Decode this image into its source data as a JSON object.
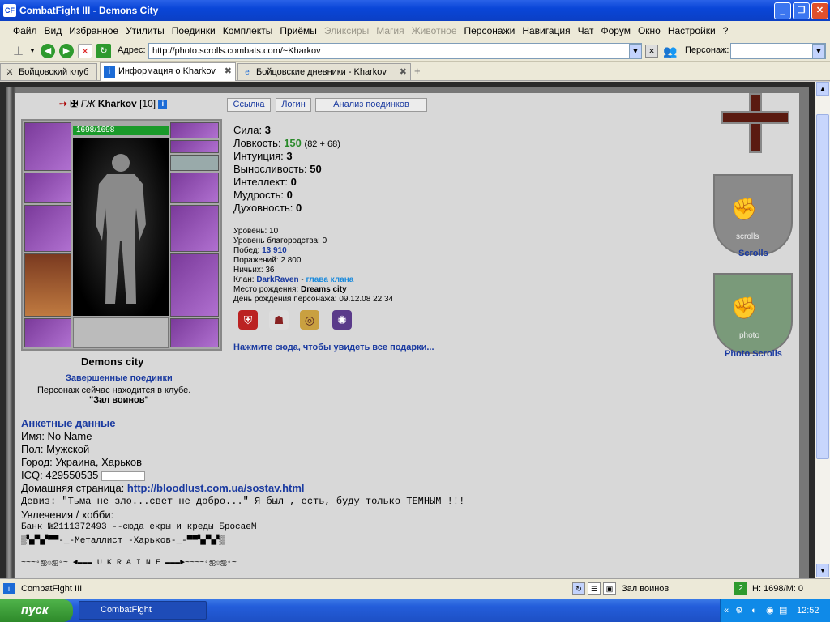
{
  "window": {
    "title": "CombatFight III - Demons City"
  },
  "menu": [
    "Файл",
    "Вид",
    "Избранное",
    "Утилиты",
    "Поединки",
    "Комплекты",
    "Приёмы",
    "Эликсиры",
    "Магия",
    "Животное",
    "Персонажи",
    "Навигация",
    "Чат",
    "Форум",
    "Окно",
    "Настройки",
    "?"
  ],
  "menu_disabled": [
    7,
    8,
    9
  ],
  "address": {
    "label": "Адрес:",
    "value": "http://photo.scrolls.combats.com/~Kharkov",
    "persona_label": "Персонаж:"
  },
  "tabs": [
    {
      "label": "Бойцовский клуб"
    },
    {
      "label": "Информация о Kharkov"
    },
    {
      "label": "Бойцовские дневники - Kharkov"
    }
  ],
  "character": {
    "name": "Kharkov",
    "level": "[10]",
    "hp": "1698/1698",
    "city": "Demons city",
    "finished_fights": "Завершенные поединки",
    "location_text": "Персонаж сейчас находится в клубе.",
    "location_room": "\"Зал воинов\""
  },
  "top_buttons": [
    "Ссылка",
    "Логин",
    "Анализ поединков"
  ],
  "stats": {
    "strength_label": "Сила:",
    "strength": "3",
    "agility_label": "Ловкость:",
    "agility": "150",
    "agility_detail": "(82 + 68)",
    "intuition_label": "Интуиция:",
    "intuition": "3",
    "endurance_label": "Выносливость:",
    "endurance": "50",
    "intellect_label": "Интеллект:",
    "intellect": "0",
    "wisdom_label": "Мудрость:",
    "wisdom": "0",
    "spirit_label": "Духовность:",
    "spirit": "0"
  },
  "info": {
    "level_label": "Уровень:",
    "level": "10",
    "nobility_label": "Уровень благородства:",
    "nobility": "0",
    "wins_label": "Побед:",
    "wins": "13 910",
    "losses_label": "Поражений:",
    "losses": "2 800",
    "draws_label": "Ничьих:",
    "draws": "36",
    "clan_label": "Клан:",
    "clan": "DarkRaven",
    "clan_sep": "-",
    "clan_role": "глава клана",
    "birthplace_label": "Место рождения:",
    "birthplace": "Dreams city",
    "birthday_label": "День рождения персонажа:",
    "birthday": "09.12.08 22:34"
  },
  "gifts_link": "Нажмите сюда, чтобы увидеть все подарки...",
  "anketa": {
    "title": "Анкетные данные",
    "name": "Имя: No Name",
    "gender": "Пол: Мужской",
    "city": "Город: Украина, Харьков",
    "icq": "ICQ: 429550535",
    "homepage_label": "Домашняя страница:",
    "homepage": "http://bloodlust.com.ua/sostav.html",
    "motto": "Девиз: \"Тьма не зло...свет не добро...\" Я был , есть, буду только ТЕМНЫМ !!!",
    "hobby_label": "Увлечения / хобби:",
    "bank": "Банк №2111372493 --сюда екры и креды БросаеМ",
    "metal": "▒▚▞▚▞▀▀-_-Металлист -Харьков-_-▀▀▚▞▚▞▒",
    "ukraine": "~~~◦ஐ۞ஐ◦~ ◄▬▬▬ U K R A I N E ▬▬▬►~~~~◦ஐ۞ஐ◦~"
  },
  "side": {
    "scrolls": "Scrolls",
    "photo_scrolls": "Photo Scrolls",
    "scrolls_banner": "scrolls",
    "photo_banner": "photo"
  },
  "status": {
    "app": "CombatFight III",
    "room": "Зал воинов",
    "hp": "H: 1698/M: 0",
    "two": "2"
  },
  "taskbar": {
    "start": "пуск",
    "item": "CombatFight",
    "time": "12:52"
  },
  "colors": {
    "accent": "#1a3aa0",
    "agility": "#2a8a2a",
    "hp": "#1a9a2a"
  }
}
